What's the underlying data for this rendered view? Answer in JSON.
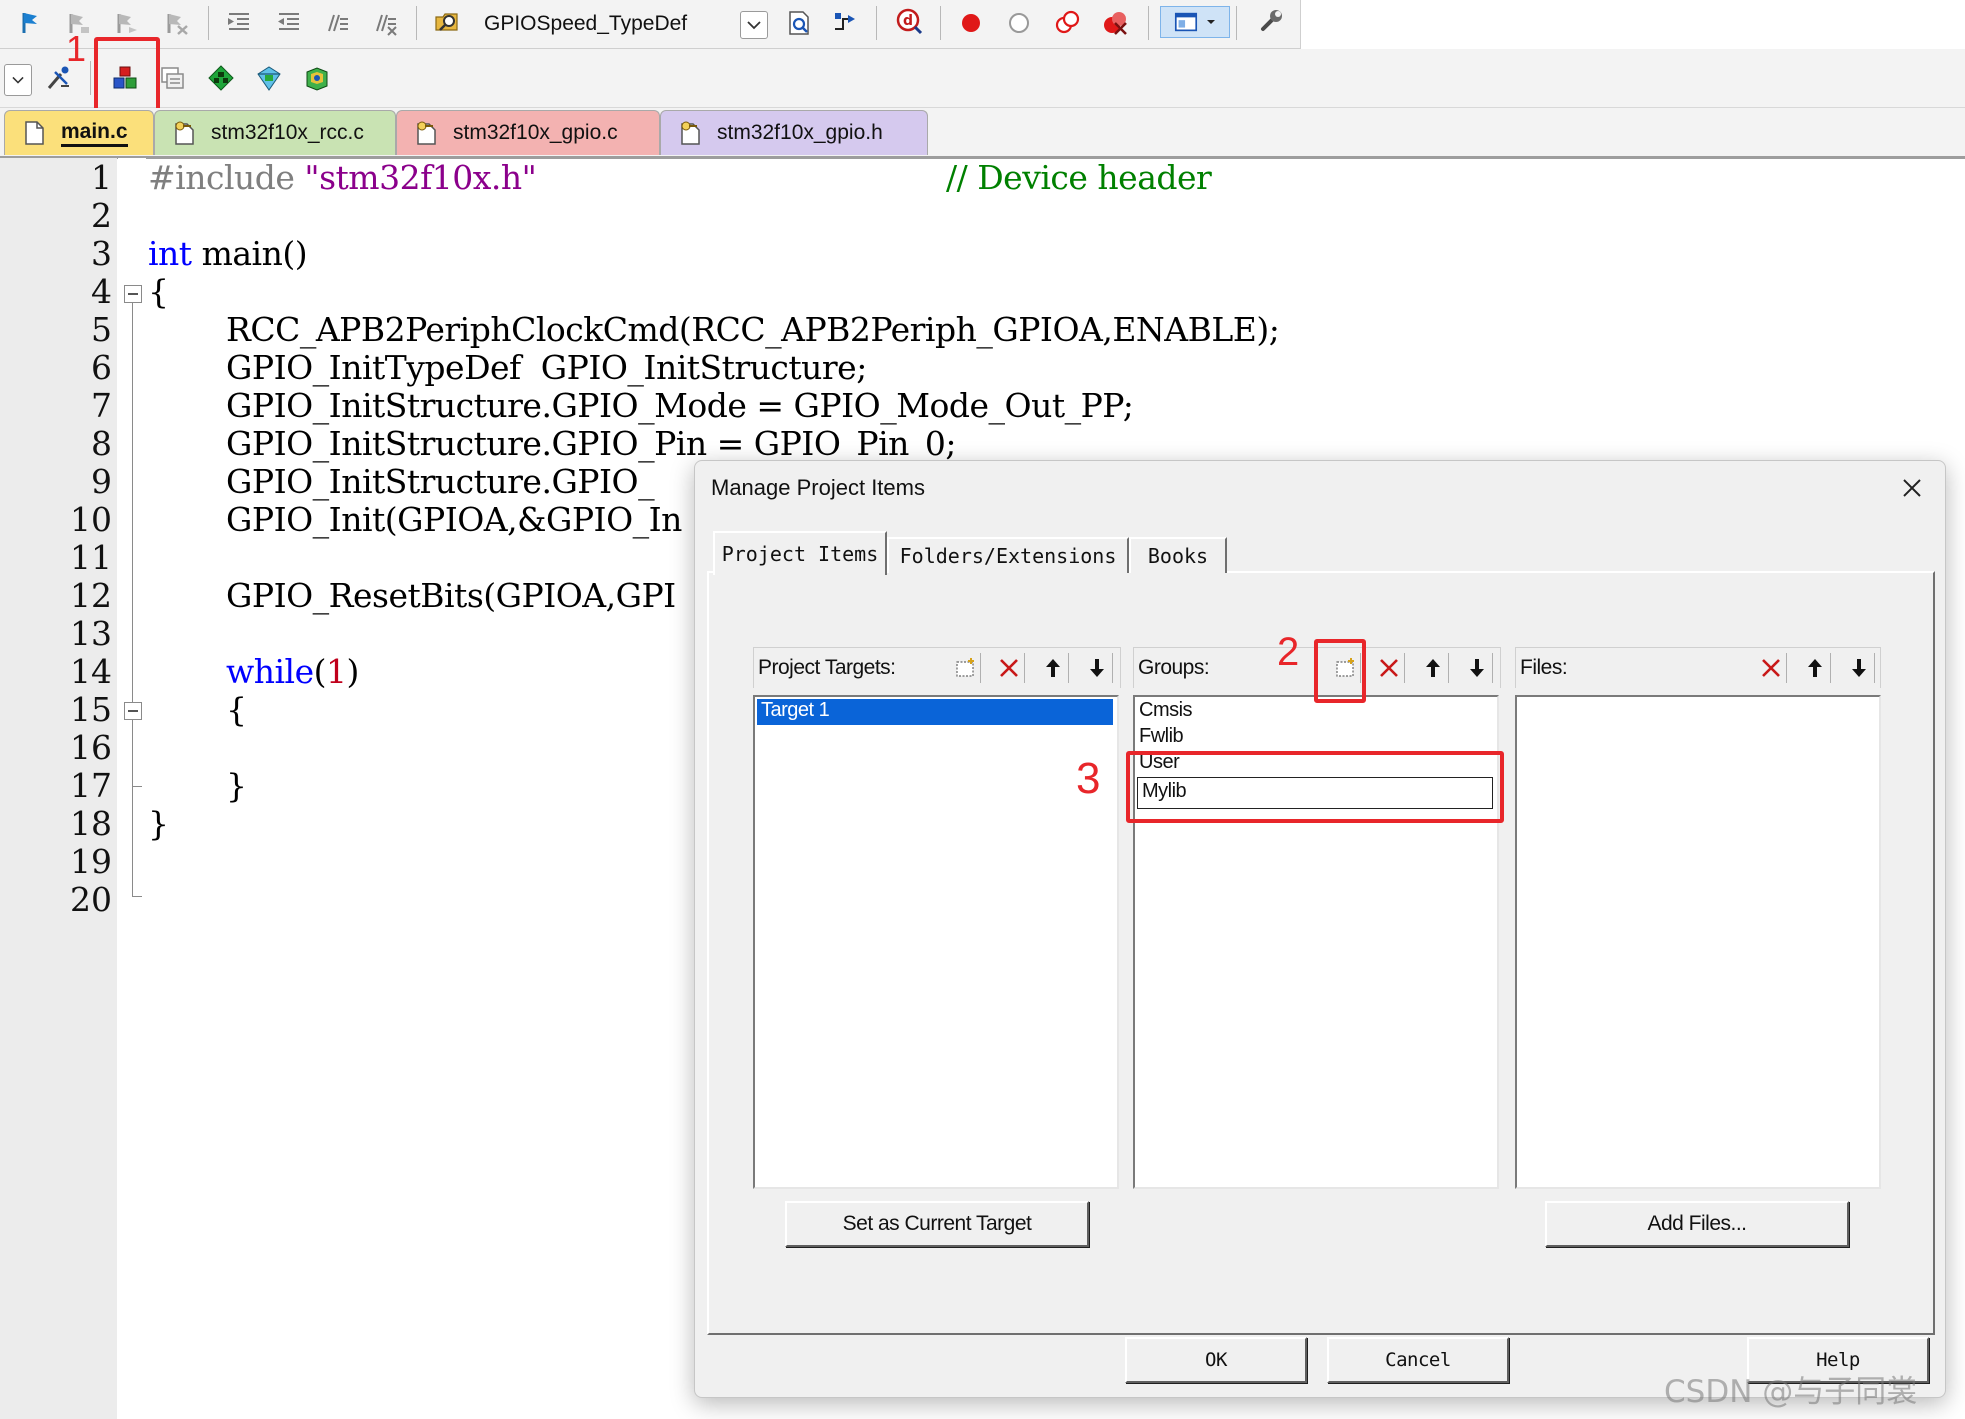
{
  "toolbar": {
    "target_combo_value": "GPIOSpeed_TypeDef"
  },
  "annotations": {
    "step1": "1",
    "step2": "2",
    "step3": "3",
    "color": "#e8262a"
  },
  "tabs": [
    {
      "label": "main.c",
      "color": "#fbe07b",
      "active": true
    },
    {
      "label": "stm32f10x_rcc.c",
      "color": "#c9e3b3",
      "active": false
    },
    {
      "label": "stm32f10x_gpio.c",
      "color": "#f3b2b1",
      "active": false
    },
    {
      "label": "stm32f10x_gpio.h",
      "color": "#d5c9ee",
      "active": false
    }
  ],
  "editor": {
    "line_numbers": [
      "1",
      "2",
      "3",
      "4",
      "5",
      "6",
      "7",
      "8",
      "9",
      "10",
      "11",
      "12",
      "13",
      "14",
      "15",
      "16",
      "17",
      "18",
      "19",
      "20"
    ],
    "line1_directive": "#include",
    "line1_string": "\"stm32f10x.h\"",
    "line1_comment": "// Device header",
    "line3_keyword": "int",
    "line3_rest": " main()",
    "line4": "{",
    "line5": "RCC_APB2PeriphClockCmd(RCC_APB2Periph_GPIOA,ENABLE);",
    "line6": "GPIO_InitTypeDef  GPIO_InitStructure;",
    "line7": "GPIO_InitStructure.GPIO_Mode = GPIO_Mode_Out_PP;",
    "line8": "GPIO_InitStructure.GPIO_Pin = GPIO_Pin_0;",
    "line9": "GPIO_InitStructure.GPIO_",
    "line10": "GPIO_Init(GPIOA,&GPIO_In",
    "line12": "GPIO_ResetBits(GPIOA,GPI",
    "line14_keyword": "while",
    "line14_open": "(",
    "line14_num": "1",
    "line14_close": ")",
    "line15": "{",
    "line17": "}",
    "line18": "}"
  },
  "dialog": {
    "title": "Manage Project Items",
    "tabs": [
      "Project Items",
      "Folders/Extensions",
      "Books"
    ],
    "targets_label": "Project Targets:",
    "groups_label": "Groups:",
    "files_label": "Files:",
    "targets": [
      "Target 1"
    ],
    "groups": [
      "Cmsis",
      "Fwlib",
      "User"
    ],
    "group_edit_value": "Mylib",
    "set_target_button": "Set as Current Target",
    "add_files_button": "Add Files...",
    "ok_button": "OK",
    "cancel_button": "Cancel",
    "help_button": "Help"
  },
  "watermark": "CSDN @与子同裳"
}
